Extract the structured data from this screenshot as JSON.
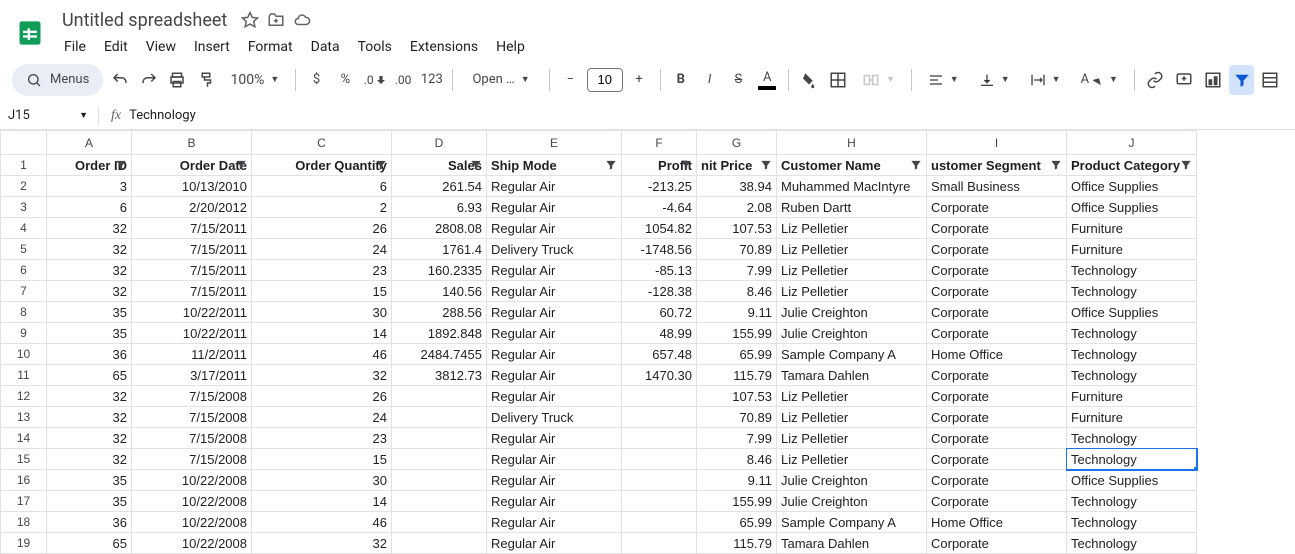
{
  "header": {
    "title": "Untitled spreadsheet",
    "menus": [
      "File",
      "Edit",
      "View",
      "Insert",
      "Format",
      "Data",
      "Tools",
      "Extensions",
      "Help"
    ]
  },
  "toolbar": {
    "search_label": "Menus",
    "zoom": "100%",
    "font": "Open …",
    "font_size": "10"
  },
  "namebox": "J15",
  "formula": "Technology",
  "columns": [
    "A",
    "B",
    "C",
    "D",
    "E",
    "F",
    "G",
    "H",
    "I",
    "J"
  ],
  "col_widths": [
    "colA",
    "colB",
    "colC",
    "colD",
    "colE",
    "colF",
    "colG",
    "colH",
    "colI",
    "colJ"
  ],
  "selected": {
    "col": 9,
    "row": 15
  },
  "headers_row": [
    "Order ID",
    "Order Date",
    "Order Quantity",
    "Sales",
    "Ship Mode",
    "Profit",
    "Unit Price",
    "Customer Name",
    "Customer Segment",
    "Product Category"
  ],
  "header_align": [
    "num",
    "num",
    "num",
    "num",
    "txt",
    "num",
    "num",
    "txt",
    "txt",
    "txt"
  ],
  "header_clip": [
    "",
    "",
    "",
    "",
    "",
    "",
    "lclip",
    "",
    "lclip",
    ""
  ],
  "rows": [
    [
      "3",
      "10/13/2010",
      "6",
      "261.54",
      "Regular Air",
      "-213.25",
      "38.94",
      "Muhammed MacIntyre",
      "Small Business",
      "Office Supplies"
    ],
    [
      "6",
      "2/20/2012",
      "2",
      "6.93",
      "Regular Air",
      "-4.64",
      "2.08",
      "Ruben Dartt",
      "Corporate",
      "Office Supplies"
    ],
    [
      "32",
      "7/15/2011",
      "26",
      "2808.08",
      "Regular Air",
      "1054.82",
      "107.53",
      "Liz Pelletier",
      "Corporate",
      "Furniture"
    ],
    [
      "32",
      "7/15/2011",
      "24",
      "1761.4",
      "Delivery Truck",
      "-1748.56",
      "70.89",
      "Liz Pelletier",
      "Corporate",
      "Furniture"
    ],
    [
      "32",
      "7/15/2011",
      "23",
      "160.2335",
      "Regular Air",
      "-85.13",
      "7.99",
      "Liz Pelletier",
      "Corporate",
      "Technology"
    ],
    [
      "32",
      "7/15/2011",
      "15",
      "140.56",
      "Regular Air",
      "-128.38",
      "8.46",
      "Liz Pelletier",
      "Corporate",
      "Technology"
    ],
    [
      "35",
      "10/22/2011",
      "30",
      "288.56",
      "Regular Air",
      "60.72",
      "9.11",
      "Julie Creighton",
      "Corporate",
      "Office Supplies"
    ],
    [
      "35",
      "10/22/2011",
      "14",
      "1892.848",
      "Regular Air",
      "48.99",
      "155.99",
      "Julie Creighton",
      "Corporate",
      "Technology"
    ],
    [
      "36",
      "11/2/2011",
      "46",
      "2484.7455",
      "Regular Air",
      "657.48",
      "65.99",
      "Sample Company A",
      "Home Office",
      "Technology"
    ],
    [
      "65",
      "3/17/2011",
      "32",
      "3812.73",
      "Regular Air",
      "1470.30",
      "115.79",
      "Tamara Dahlen",
      "Corporate",
      "Technology"
    ],
    [
      "32",
      "7/15/2008",
      "26",
      "",
      "Regular Air",
      "",
      "107.53",
      "Liz Pelletier",
      "Corporate",
      "Furniture"
    ],
    [
      "32",
      "7/15/2008",
      "24",
      "",
      "Delivery Truck",
      "",
      "70.89",
      "Liz Pelletier",
      "Corporate",
      "Furniture"
    ],
    [
      "32",
      "7/15/2008",
      "23",
      "",
      "Regular Air",
      "",
      "7.99",
      "Liz Pelletier",
      "Corporate",
      "Technology"
    ],
    [
      "32",
      "7/15/2008",
      "15",
      "",
      "Regular Air",
      "",
      "8.46",
      "Liz Pelletier",
      "Corporate",
      "Technology"
    ],
    [
      "35",
      "10/22/2008",
      "30",
      "",
      "Regular Air",
      "",
      "9.11",
      "Julie Creighton",
      "Corporate",
      "Office Supplies"
    ],
    [
      "35",
      "10/22/2008",
      "14",
      "",
      "Regular Air",
      "",
      "155.99",
      "Julie Creighton",
      "Corporate",
      "Technology"
    ],
    [
      "36",
      "10/22/2008",
      "46",
      "",
      "Regular Air",
      "",
      "65.99",
      "Sample Company A",
      "Home Office",
      "Technology"
    ],
    [
      "65",
      "10/22/2008",
      "32",
      "",
      "Regular Air",
      "",
      "115.79",
      "Tamara Dahlen",
      "Corporate",
      "Technology"
    ]
  ],
  "col_align": [
    "num",
    "num",
    "num",
    "num",
    "txt",
    "num",
    "num",
    "txt",
    "txt",
    "txt"
  ]
}
